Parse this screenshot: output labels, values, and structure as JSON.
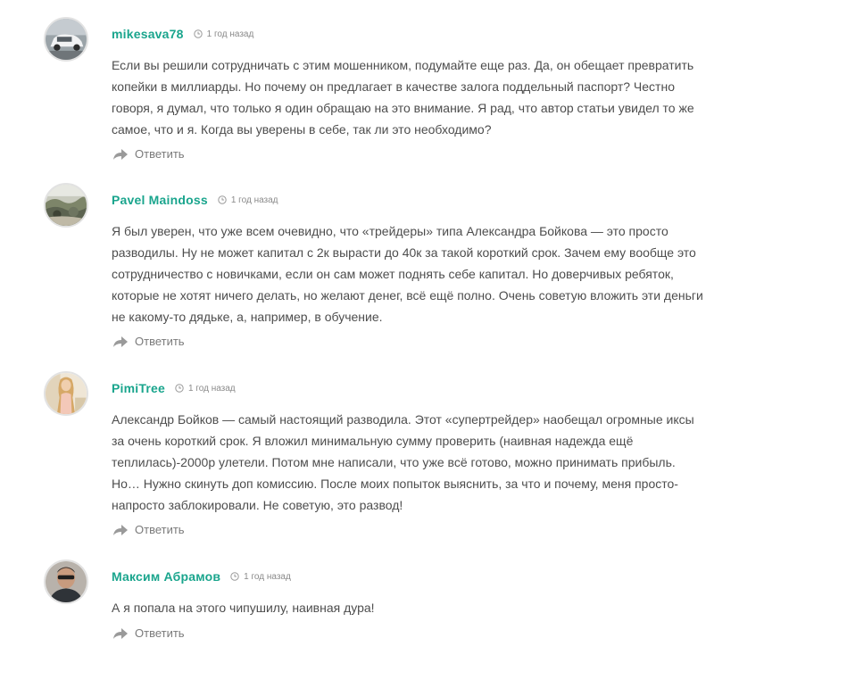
{
  "accent_color": "#1aa58d",
  "comments": [
    {
      "author": "mikesava78",
      "date": "1 год назад",
      "avatar_icon": "car-photo-avatar",
      "text_lines": [
        "Если вы решили сотрудничать с этим мошенником, подумайте еще раз. Да, он обещает превратить",
        "копейки в миллиарды. Но почему он предлагает в качестве залога поддельный паспорт? Честно",
        "говоря, я думал, что только я один обращаю на это внимание. Я рад, что автор статьи увидел то же",
        "самое, что и я. Когда вы уверены в себе, так ли это необходимо?"
      ],
      "reply_label": "Ответить"
    },
    {
      "author": "Pavel Maindoss",
      "date": "1 год назад",
      "avatar_icon": "landscape-photo-avatar",
      "text_lines": [
        "Я был уверен, что уже всем очевидно, что «трейдеры» типа Александра Бойкова — это просто",
        "разводилы. Ну не может капитал с 2к вырасти до 40к за такой короткий срок. Зачем ему вообще это",
        "сотрудничество с новичками, если он сам может поднять себе капитал. Но доверчивых ребяток,",
        "которые не хотят ничего делать, но желают денег, всё ещё полно. Очень советую вложить эти деньги",
        "не какому-то дядьке, а, например, в обучение."
      ],
      "reply_label": "Ответить"
    },
    {
      "author": "PimiTree",
      "date": "1 год назад",
      "avatar_icon": "woman-photo-avatar",
      "text_lines": [
        "Александр Бойков — самый настоящий разводила. Этот «супертрейдер» наобещал огромные иксы",
        "за очень короткий срок. Я вложил минимальную сумму проверить (наивная надежда ещё",
        "теплилась)-2000р улетели. Потом мне написали, что уже всё готово, можно принимать прибыль.",
        "Но… Нужно скинуть доп комиссию. После моих попыток выяснить, за что и почему, меня просто-",
        "напросто заблокировали. Не советую, это развод!"
      ],
      "reply_label": "Ответить"
    },
    {
      "author": "Максим Абрамов",
      "date": "1 год назад",
      "avatar_icon": "man-photo-avatar",
      "text_lines": [
        "А я попала на этого чипушилу, наивная дура!"
      ],
      "reply_label": "Ответить"
    }
  ]
}
